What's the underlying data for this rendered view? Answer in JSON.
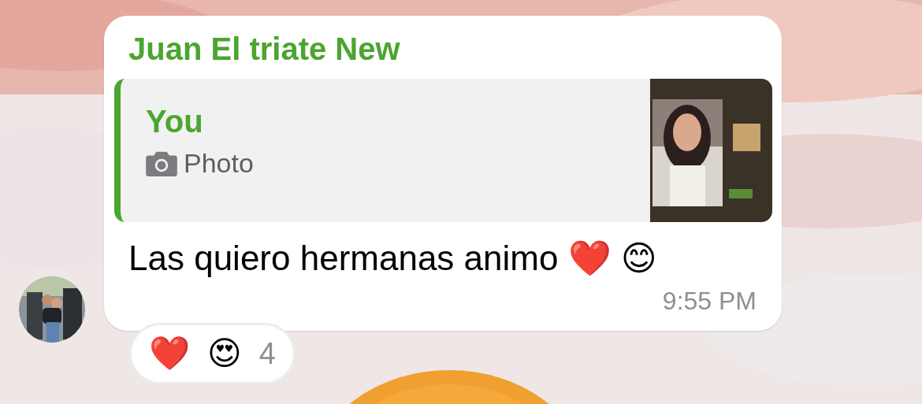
{
  "message": {
    "sender": "Juan El triate New",
    "reply": {
      "author": "You",
      "media_label": "Photo"
    },
    "text": "Las quiero hermanas animo ❤️ 😊",
    "time": "9:55 PM"
  },
  "reactions": {
    "emojis": [
      "❤️",
      "😍"
    ],
    "count": "4"
  }
}
